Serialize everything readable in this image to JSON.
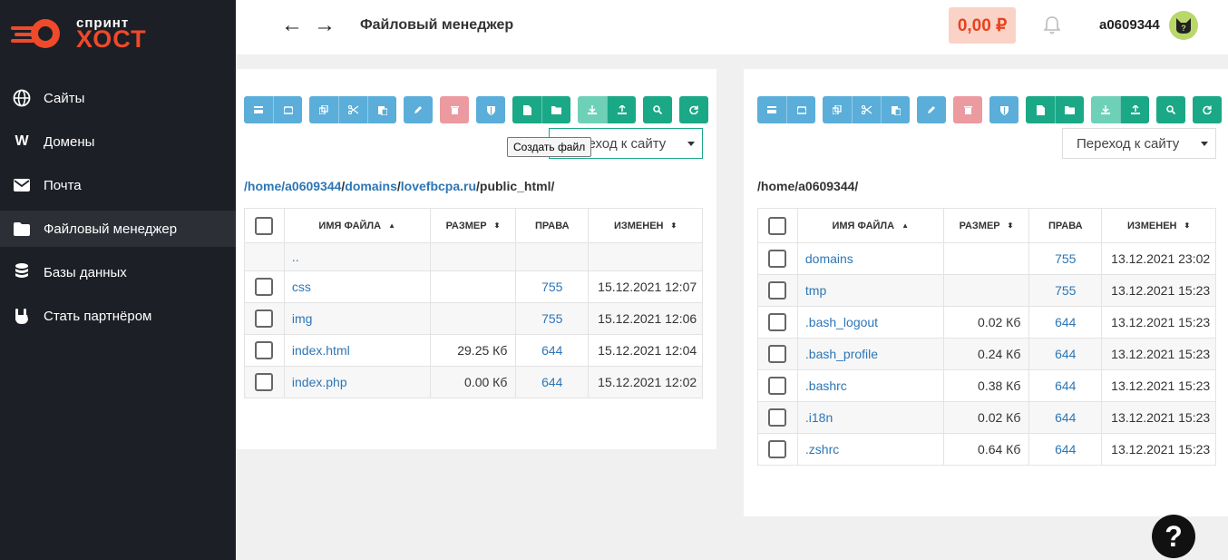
{
  "brand": {
    "line1": "спринт",
    "line2": "ХОСТ"
  },
  "sidebar": {
    "items": [
      {
        "label": "Сайты",
        "icon": "globe-icon"
      },
      {
        "label": "Домены",
        "icon": "w-icon"
      },
      {
        "label": "Почта",
        "icon": "envelope-icon"
      },
      {
        "label": "Файловый менеджер",
        "icon": "folder-icon"
      },
      {
        "label": "Базы данных",
        "icon": "database-icon"
      },
      {
        "label": "Стать партнёром",
        "icon": "hand-icon"
      }
    ]
  },
  "header": {
    "back": "←",
    "forward": "→",
    "title": "Файловый менеджер",
    "balance": "0,00 ₽",
    "username": "a0609344"
  },
  "left": {
    "goto": "Переход к сайту",
    "tooltip": "Создать файл",
    "path": {
      "p1": "/home/a0609344",
      "p2": "domains",
      "p3": "lovefbcpa.ru",
      "p4": "public_html/"
    },
    "columns": {
      "name": "Имя файла",
      "size": "Размер",
      "rights": "Права",
      "modified": "Изменен"
    },
    "rows": [
      {
        "name": "..",
        "size": "",
        "rights": "",
        "modified": ""
      },
      {
        "name": "css",
        "size": "",
        "rights": "755",
        "modified": "15.12.2021 12:07"
      },
      {
        "name": "img",
        "size": "",
        "rights": "755",
        "modified": "15.12.2021 12:06"
      },
      {
        "name": "index.html",
        "size": "29.25 Кб",
        "rights": "644",
        "modified": "15.12.2021 12:04"
      },
      {
        "name": "index.php",
        "size": "0.00 Кб",
        "rights": "644",
        "modified": "15.12.2021 12:02"
      }
    ]
  },
  "right": {
    "goto": "Переход к сайту",
    "path": "/home/a0609344/",
    "columns": {
      "name": "Имя файла",
      "size": "Размер",
      "rights": "Права",
      "modified": "Изменен"
    },
    "rows": [
      {
        "name": "domains",
        "size": "",
        "rights": "755",
        "modified": "13.12.2021 23:02"
      },
      {
        "name": "tmp",
        "size": "",
        "rights": "755",
        "modified": "13.12.2021 15:23"
      },
      {
        "name": ".bash_logout",
        "size": "0.02 Кб",
        "rights": "644",
        "modified": "13.12.2021 15:23"
      },
      {
        "name": ".bash_profile",
        "size": "0.24 Кб",
        "rights": "644",
        "modified": "13.12.2021 15:23"
      },
      {
        "name": ".bashrc",
        "size": "0.38 Кб",
        "rights": "644",
        "modified": "13.12.2021 15:23"
      },
      {
        "name": ".i18n",
        "size": "0.02 Кб",
        "rights": "644",
        "modified": "13.12.2021 15:23"
      },
      {
        "name": ".zshrc",
        "size": "0.64 Кб",
        "rights": "644",
        "modified": "13.12.2021 15:23"
      }
    ]
  },
  "help": "?",
  "colors": {
    "sidebar": "#1d1f26",
    "accent": "#ef4a2a",
    "link": "#2d76b6",
    "green": "#1ba886",
    "blue": "#5aaed9"
  }
}
